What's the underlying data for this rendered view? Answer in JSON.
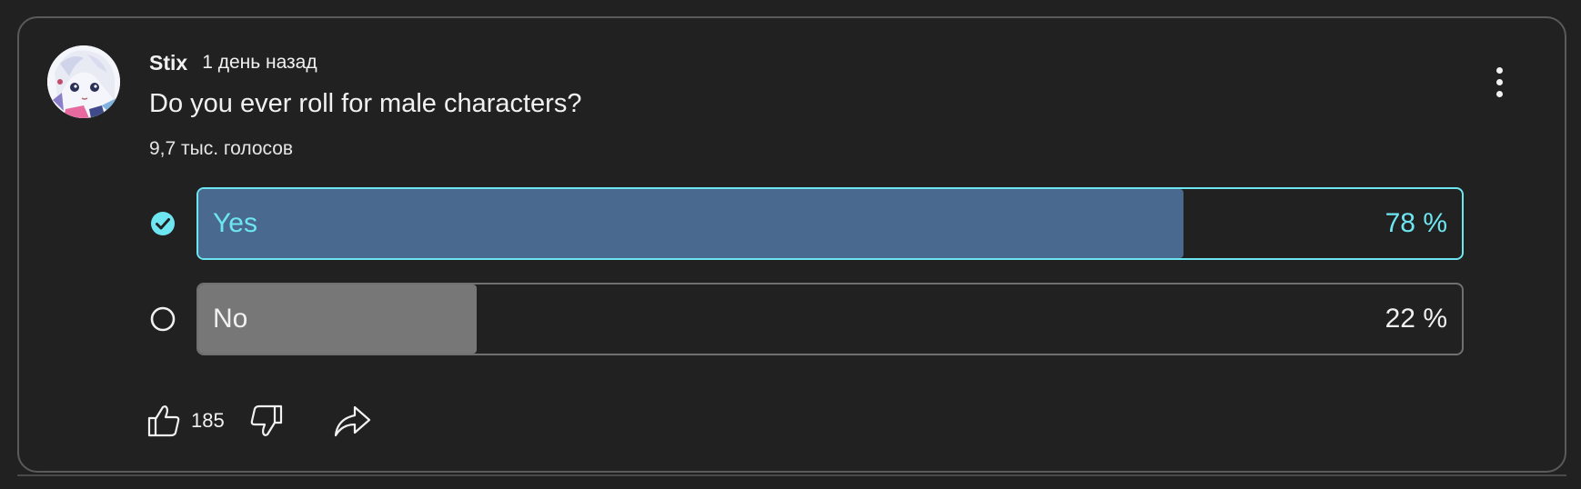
{
  "post": {
    "author": "Stix",
    "time": "1 день назад",
    "question": "Do you ever roll for male characters?",
    "vote_count": "9,7 тыс. голосов"
  },
  "poll": {
    "options": [
      {
        "label": "Yes",
        "percent_text": "78 %",
        "percent": 78,
        "selected": true
      },
      {
        "label": "No",
        "percent_text": "22 %",
        "percent": 22,
        "selected": false
      }
    ]
  },
  "actions": {
    "like_count": "185",
    "icons": [
      "thumbs-up-icon",
      "thumbs-down-icon",
      "share-icon",
      "more-vert-icon"
    ]
  },
  "colors": {
    "background": "#212121",
    "selected_accent": "#6ee6f2",
    "selected_fill": "#496a8e",
    "unselected_fill": "#777777",
    "text": "#f1f1f1"
  }
}
